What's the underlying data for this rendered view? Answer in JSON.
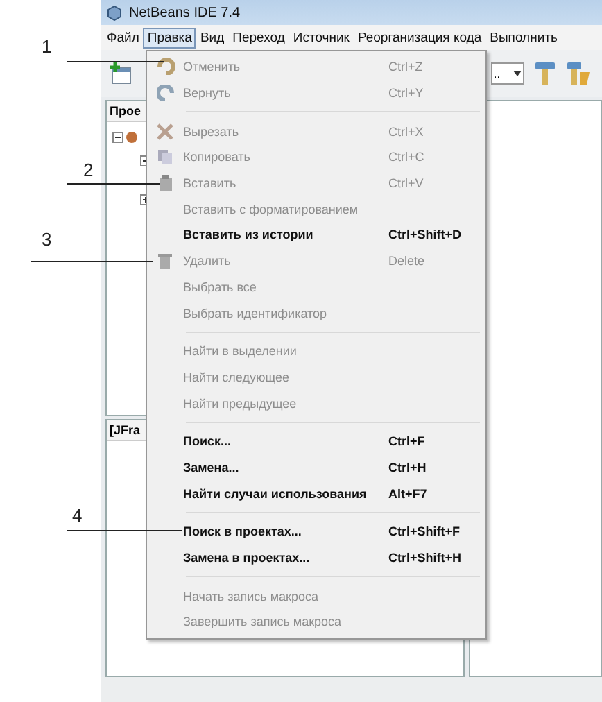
{
  "window": {
    "title": "NetBeans IDE 7.4"
  },
  "menubar": [
    {
      "label": "Файл",
      "selected": false
    },
    {
      "label": "Правка",
      "selected": true
    },
    {
      "label": "Вид",
      "selected": false
    },
    {
      "label": "Переход",
      "selected": false
    },
    {
      "label": "Источник",
      "selected": false
    },
    {
      "label": "Реорганизация кода",
      "selected": false
    },
    {
      "label": "Выполнить",
      "selected": false
    }
  ],
  "toolbar": {
    "combo_text": ".."
  },
  "projects_panel": {
    "tab": "Прое"
  },
  "navigator_panel": {
    "tab": "[JFra"
  },
  "edit_menu": [
    [
      {
        "label": "Отменить",
        "shortcut": "Ctrl+Z",
        "disabled": true
      },
      {
        "label": "Вернуть",
        "shortcut": "Ctrl+Y",
        "disabled": true
      }
    ],
    [
      {
        "label": "Вырезать",
        "shortcut": "Ctrl+X",
        "disabled": true
      },
      {
        "label": "Копировать",
        "shortcut": "Ctrl+C",
        "disabled": true
      },
      {
        "label": "Вставить",
        "shortcut": "Ctrl+V",
        "disabled": true
      },
      {
        "label": "Вставить с форматированием",
        "disabled": true
      },
      {
        "label": "Вставить из истории",
        "shortcut": "Ctrl+Shift+D",
        "disabled": false
      },
      {
        "label": "Удалить",
        "shortcut": "Delete",
        "disabled": true
      },
      {
        "label": "Выбрать все",
        "disabled": true
      },
      {
        "label": "Выбрать идентификатор",
        "disabled": true
      }
    ],
    [
      {
        "label": "Найти в выделении",
        "disabled": true
      },
      {
        "label": "Найти следующее",
        "disabled": true
      },
      {
        "label": "Найти предыдущее",
        "disabled": true
      }
    ],
    [
      {
        "label": "Поиск...",
        "shortcut": "Ctrl+F",
        "disabled": false
      },
      {
        "label": "Замена...",
        "shortcut": "Ctrl+H",
        "disabled": false
      },
      {
        "label": "Найти случаи использования",
        "shortcut": "Alt+F7",
        "disabled": false
      }
    ],
    [
      {
        "label": "Поиск в проектах...",
        "shortcut": "Ctrl+Shift+F",
        "disabled": false
      },
      {
        "label": "Замена в проектах...",
        "shortcut": "Ctrl+Shift+H",
        "disabled": false
      }
    ],
    [
      {
        "label": "Начать запись макроса",
        "disabled": true
      },
      {
        "label": "Завершить запись макроса",
        "disabled": true
      }
    ]
  ],
  "callouts": [
    {
      "label": "1"
    },
    {
      "label": "2"
    },
    {
      "label": "3"
    },
    {
      "label": "4"
    }
  ]
}
